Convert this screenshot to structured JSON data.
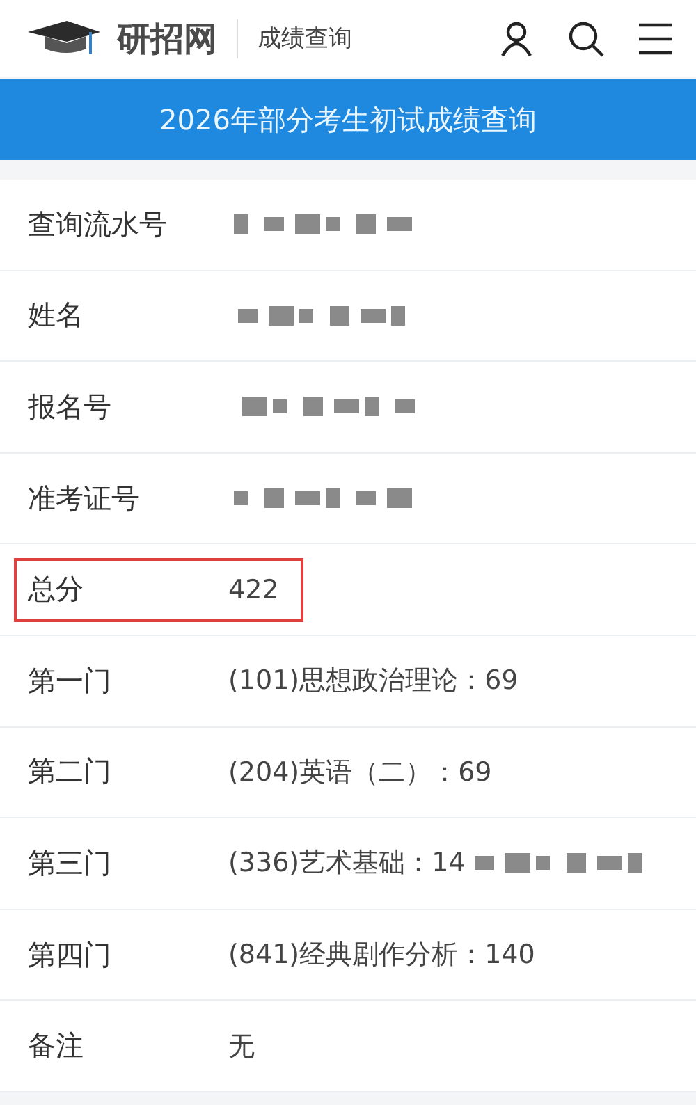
{
  "header": {
    "site_name": "研招网",
    "section": "成绩查询"
  },
  "banner": {
    "title": "2026年部分考生初试成绩查询"
  },
  "rows": [
    {
      "label": "查询流水号",
      "redacted": true,
      "highlighted": false
    },
    {
      "label": "姓名",
      "redacted": true,
      "highlighted": false
    },
    {
      "label": "报名号",
      "redacted": true,
      "highlighted": false
    },
    {
      "label": "准考证号",
      "redacted": true,
      "highlighted": false
    },
    {
      "label": "总分",
      "value": "422",
      "redacted": false,
      "highlighted": true
    },
    {
      "label": "第一门",
      "value": "(101)思想政治理论：69",
      "redacted": false,
      "highlighted": false
    },
    {
      "label": "第二门",
      "value": "(204)英语（二）：69",
      "redacted": false,
      "highlighted": false
    },
    {
      "label": "第三门",
      "value": "(336)艺术基础：14",
      "redacted": true,
      "highlighted": false
    },
    {
      "label": "第四门",
      "value": "(841)经典剧作分析：140",
      "redacted": false,
      "highlighted": false
    },
    {
      "label": "备注",
      "value": "无",
      "redacted": false,
      "highlighted": false
    }
  ]
}
